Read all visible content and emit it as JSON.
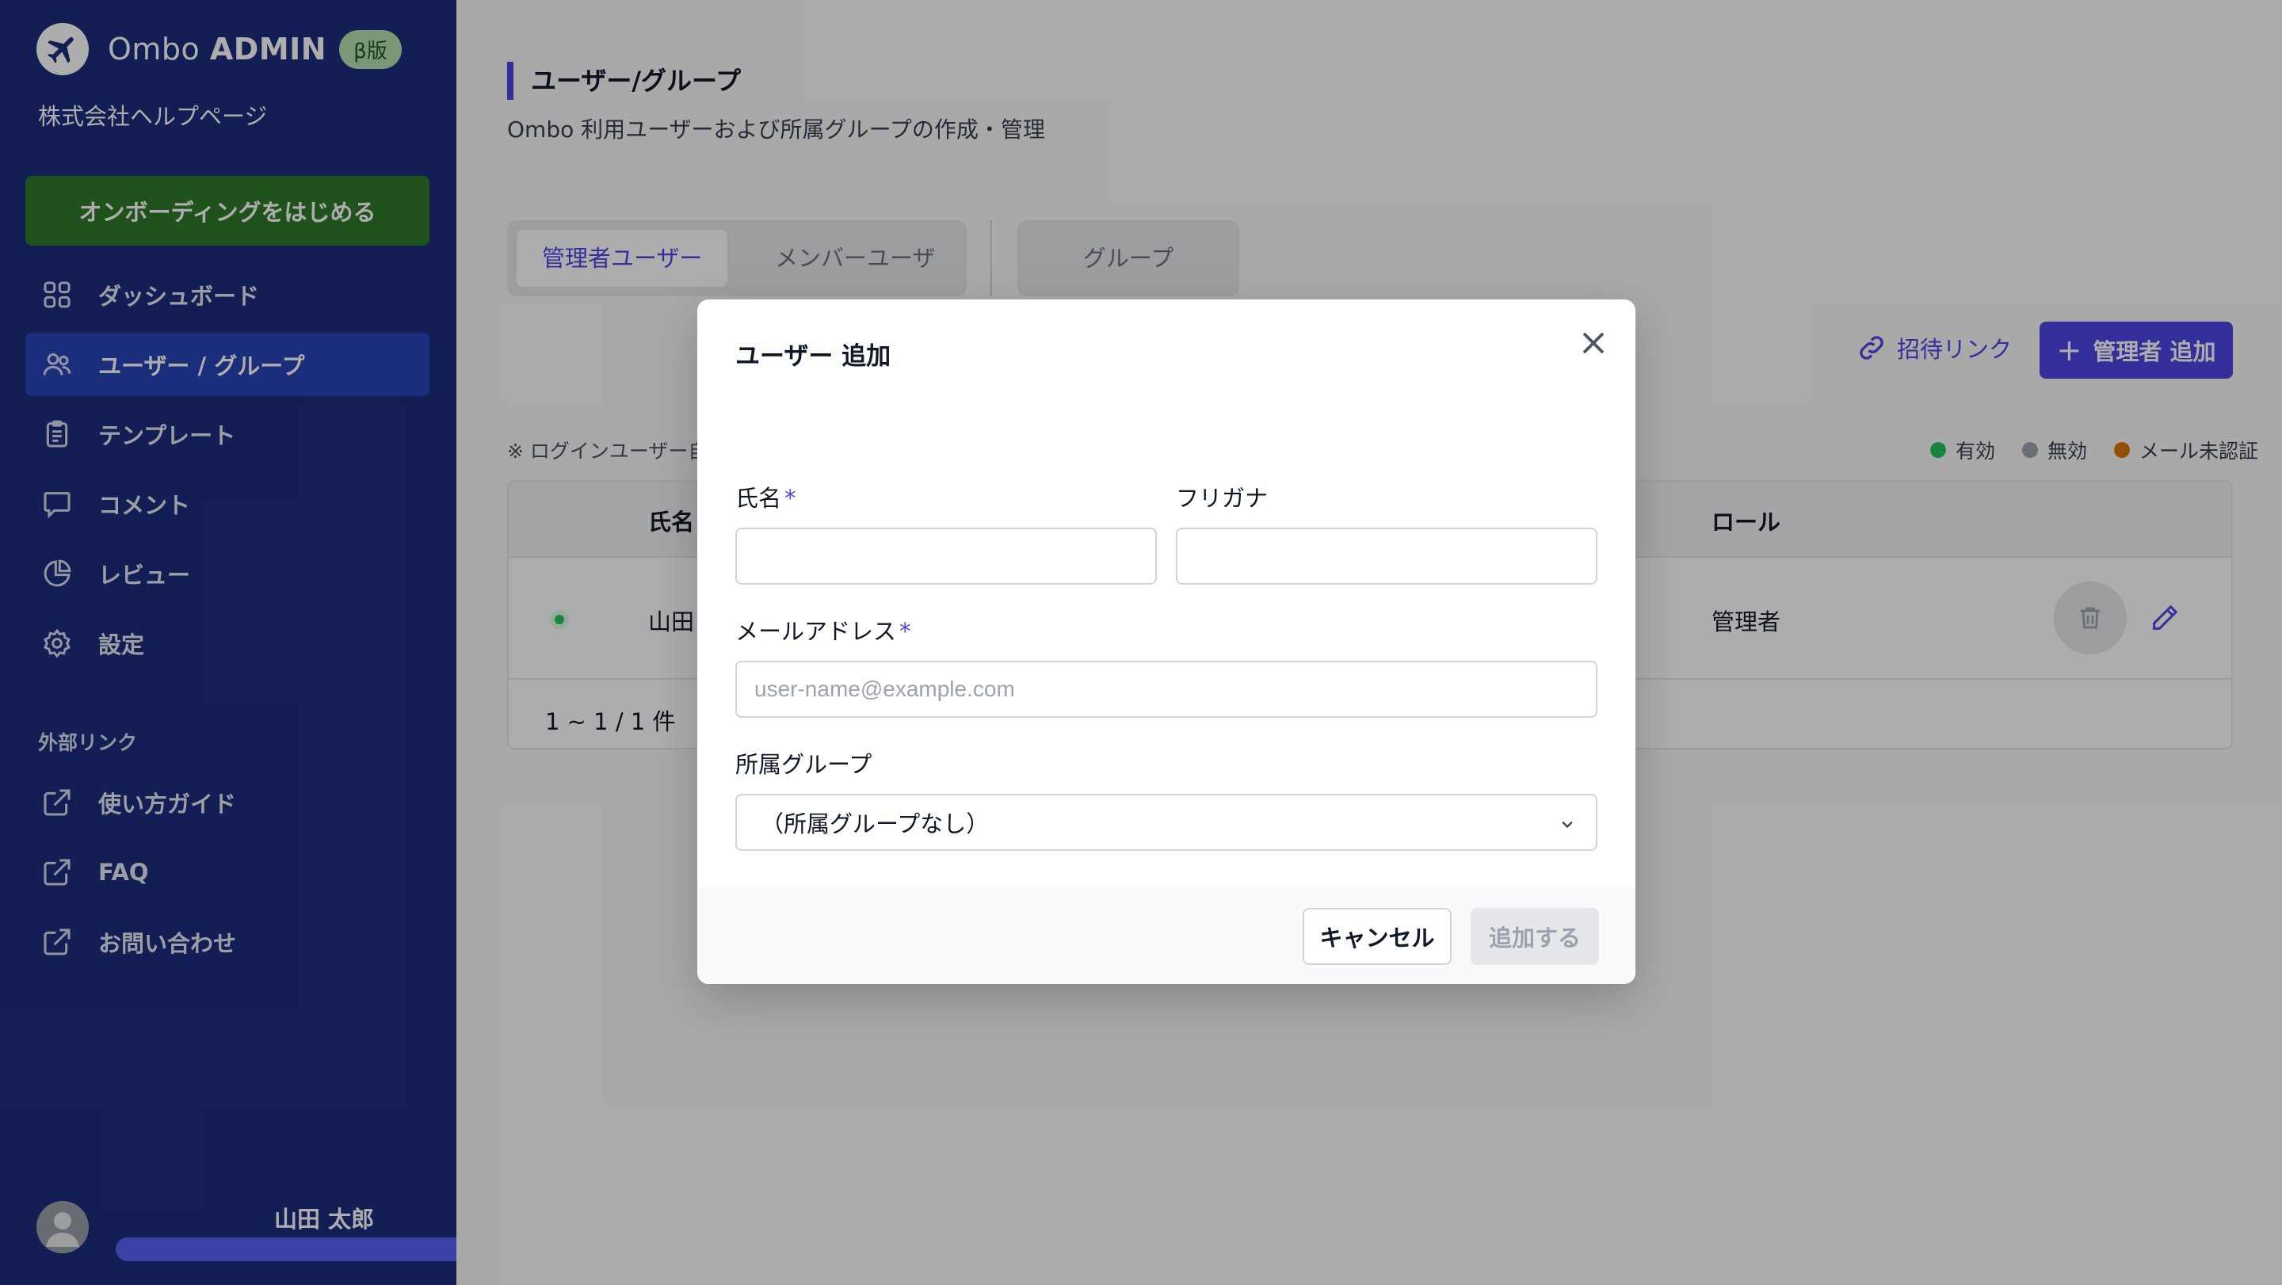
{
  "sidebar": {
    "brand": {
      "name_light": "Ombo",
      "name_bold": "ADMIN",
      "badge": "β版"
    },
    "company": "株式会社ヘルプページ",
    "onboarding_label": "オンボーディングをはじめる",
    "nav": [
      {
        "label": "ダッシュボード",
        "icon": "dashboard-icon",
        "active": false
      },
      {
        "label": "ユーザー / グループ",
        "icon": "users-icon",
        "active": true
      },
      {
        "label": "テンプレート",
        "icon": "template-icon",
        "active": false
      },
      {
        "label": "コメント",
        "icon": "comment-icon",
        "active": false
      },
      {
        "label": "レビュー",
        "icon": "review-icon",
        "active": false
      },
      {
        "label": "設定",
        "icon": "gear-icon",
        "active": false
      }
    ],
    "external_section": "外部リンク",
    "external": [
      {
        "label": "使い方ガイド",
        "icon": "external-link-icon"
      },
      {
        "label": "FAQ",
        "icon": "external-link-icon"
      },
      {
        "label": "お問い合わせ",
        "icon": "external-link-icon"
      }
    ],
    "user_name": "山田 太郎"
  },
  "main": {
    "title": "ユーザー/グループ",
    "subtitle": "Ombo 利用ユーザーおよび所属グループの作成・管理",
    "tabs": [
      "管理者ユーザー",
      "メンバーユーザー"
    ],
    "group_tab": "グループ",
    "invite_link": "招待リンク",
    "add_admin": "管理者 追加",
    "note": "※ ログインユーザー自",
    "legend": [
      {
        "label": "有効",
        "color": "#22c55e"
      },
      {
        "label": "無効",
        "color": "#9ca3af"
      },
      {
        "label": "メール未認証",
        "color": "#d97706"
      }
    ],
    "table": {
      "headers": {
        "name": "氏名",
        "role": "ロール"
      },
      "rows": [
        {
          "name": "山田",
          "role": "管理者"
        }
      ],
      "pagination": "1 ~ 1 / 1 件"
    }
  },
  "modal": {
    "title": "ユーザー 追加",
    "name_label": "氏名",
    "furigana_label": "フリガナ",
    "email_label": "メールアドレス",
    "email_placeholder": "user-name@example.com",
    "group_label": "所属グループ",
    "group_value": "（所属グループなし）",
    "required_mark": "*",
    "cancel": "キャンセル",
    "submit": "追加する"
  },
  "colors": {
    "sidebar": "#1d2f7d",
    "sidebar_active": "#2944b7",
    "onboarding": "#2e7a2a",
    "accent": "#4f46e5"
  }
}
